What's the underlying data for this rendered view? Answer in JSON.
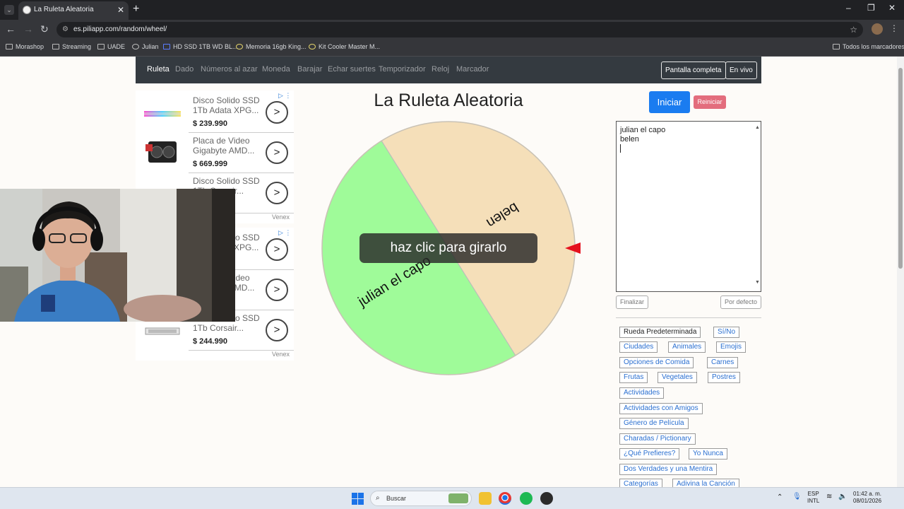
{
  "browser": {
    "tab_title": "La Ruleta Aleatoria",
    "url": "es.piliapp.com/random/wheel/",
    "bookmarks": [
      "Morashop",
      "Streaming",
      "UADE",
      "Julian",
      "HD SSD 1TB WD BL...",
      "Memoria 16gb King...",
      "Kit Cooler Master M...",
      "Todos los marcadores"
    ]
  },
  "nav": {
    "links": [
      "Ruleta",
      "Dado",
      "Números al azar",
      "Moneda",
      "Barajar",
      "Echar suertes",
      "Temporizador",
      "Reloj",
      "Marcador"
    ],
    "fullscreen": "Pantalla completa",
    "live": "En vivo"
  },
  "page_title": "La Ruleta Aleatoria",
  "ads": [
    {
      "title": "Disco Solido SSD 1Tb Adata XPG...",
      "price": "$ 239.990"
    },
    {
      "title": "Placa de Video Gigabyte AMD...",
      "price": "$ 669.999"
    },
    {
      "title": "Disco Solido SSD 1Tb Corsair...",
      "price": ""
    },
    {
      "title": "Disco Solido SSD 1Tb Adata XPG...",
      "price": ""
    },
    {
      "title": "Placa de Video Gigabyte AMD...",
      "price": ""
    },
    {
      "title": "Disco Solido SSD 1Tb Corsair...",
      "price": "$ 244.990"
    }
  ],
  "ad_brand": "Venex",
  "wheel": {
    "segments": [
      {
        "label": "belen",
        "color": "#f5dfb9"
      },
      {
        "label": "julian el capo",
        "color": "#9ffb99"
      }
    ],
    "spin_label": "haz clic para girarlo",
    "pointer_color": "#e5121e"
  },
  "controls": {
    "start": "Iniciar",
    "reset": "Reiniciar",
    "entries": [
      "julian el capo",
      "belen"
    ],
    "finish": "Finalizar",
    "default": "Por defecto"
  },
  "presets": [
    "Rueda Predeterminada",
    "Sí/No",
    "Ciudades",
    "Animales",
    "Emojis",
    "Opciones de Comida",
    "Carnes",
    "Frutas",
    "Vegetales",
    "Postres",
    "Actividades",
    "Actividades con Amigos",
    "Género de Película",
    "Charadas / Pictionary",
    "¿Qué Prefieres?",
    "Yo Nunca",
    "Dos Verdades y una Mentira",
    "Categorías",
    "Adivina la Canción"
  ],
  "taskbar": {
    "search": "Buscar",
    "lang": "ESP",
    "layout": "INTL",
    "time": "01:42 a. m.",
    "date": "08/01/2026"
  }
}
